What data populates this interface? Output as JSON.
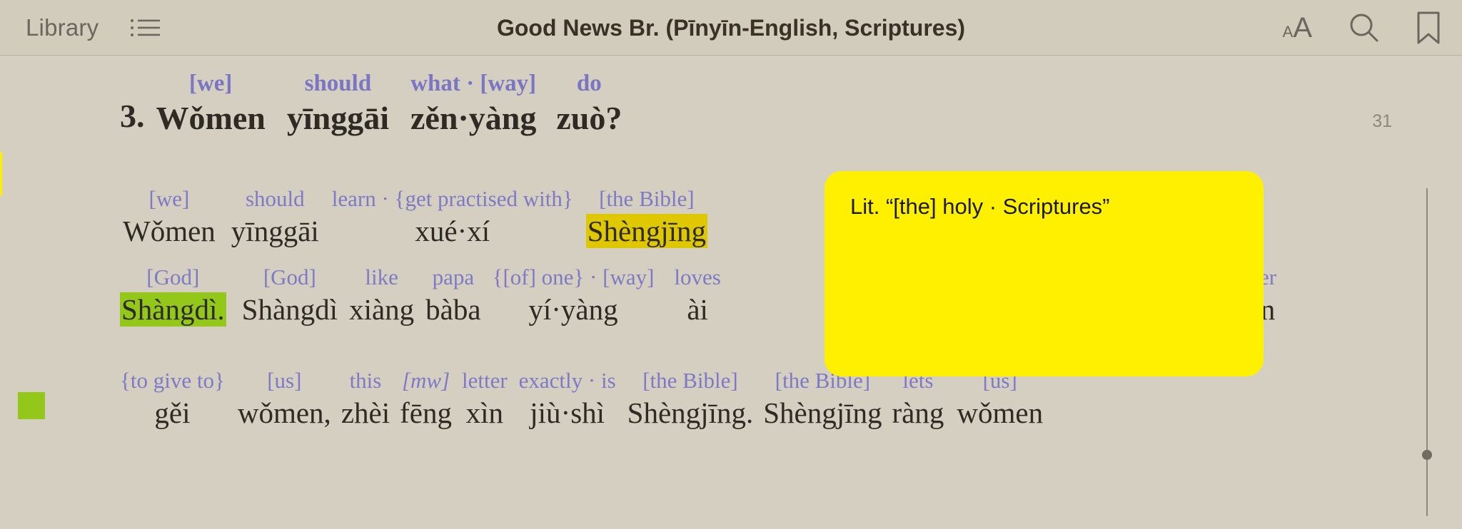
{
  "app": {
    "background_color": "#d4cfc0",
    "accent_gloss_color": "#7a76c4",
    "highlight_yellow": "#e0c800",
    "highlight_green": "#93c81a",
    "popup_color": "#fff000"
  },
  "topbar": {
    "library_label": "Library",
    "contents_icon": "list-icon",
    "title": "Good News Br. (Pīnyīn-English, Scriptures)",
    "text_size_icon": "text-size-icon",
    "text_size_small": "A",
    "text_size_large": "A",
    "search_icon": "search-icon",
    "bookmark_icon": "bookmark-icon"
  },
  "reader": {
    "page_number": "31",
    "paragraph_marker": "green-square-marker",
    "paragraphs": [
      {
        "number": "3.",
        "words": [
          {
            "gloss": "[we]",
            "pinyin": "Wǒmen"
          },
          {
            "gloss": "should",
            "pinyin": "yīnggāi"
          },
          {
            "gloss": "what · [way]",
            "pinyin": "zěn·yàng"
          },
          {
            "gloss": "do",
            "pinyin": "zuò?"
          }
        ]
      },
      {
        "number": "",
        "words": [
          {
            "gloss": "[we]",
            "pinyin": "Wǒmen"
          },
          {
            "gloss": "should",
            "pinyin": "yīnggāi"
          },
          {
            "gloss": "learn · {get practised with}",
            "pinyin": "xué·xí"
          },
          {
            "gloss": "[the  Bible]",
            "pinyin": "Shèngjīng",
            "highlight": "yellow"
          }
        ]
      },
      {
        "number": "",
        "words": [
          {
            "gloss": "[God]",
            "pinyin": "Shàngdì.",
            "highlight": "green"
          },
          {
            "gloss": "[God]",
            "pinyin": "Shàngdì"
          },
          {
            "gloss": "like",
            "pinyin": "xiàng"
          },
          {
            "gloss": "papa",
            "pinyin": "bàba"
          },
          {
            "gloss": "{[of] one} · [way]",
            "pinyin": "yí·yàng"
          },
          {
            "gloss": "loves",
            "pinyin": "ài"
          },
          {
            "gloss": "er",
            "pinyin": "n",
            "occluded": true
          }
        ]
      },
      {
        "number": "",
        "words": [
          {
            "gloss": "{to give to}",
            "pinyin": "gěi"
          },
          {
            "gloss": "[us]",
            "pinyin": "wǒmen,"
          },
          {
            "gloss": "this",
            "pinyin": "zhèi"
          },
          {
            "gloss": "[mw]",
            "pinyin": "fēng",
            "italic_gloss": true
          },
          {
            "gloss": "letter",
            "pinyin": "xìn"
          },
          {
            "gloss": "exactly · is",
            "pinyin": "jiù·shì"
          },
          {
            "gloss": "[the  Bible]",
            "pinyin": "Shèngjīng."
          },
          {
            "gloss": "[the  Bible]",
            "pinyin": "Shèngjīng"
          },
          {
            "gloss": "lets",
            "pinyin": "ràng"
          },
          {
            "gloss": "[us]",
            "pinyin": "wǒmen"
          }
        ]
      }
    ]
  },
  "popup": {
    "text": "Lit. “[the] holy · Scriptures”"
  },
  "scrollbar": {
    "position_label": "scroll-thumb"
  }
}
